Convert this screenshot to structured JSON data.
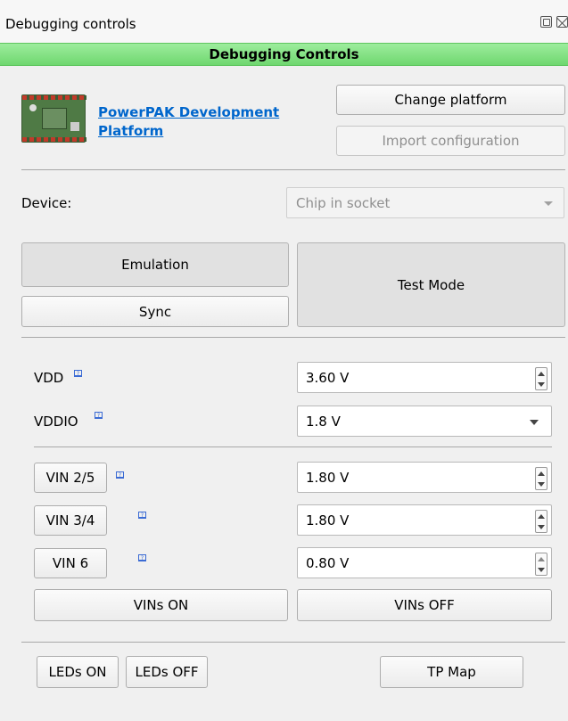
{
  "window": {
    "title": "Debugging controls",
    "restore_icon": "restore-icon",
    "close_icon": "close-icon"
  },
  "header": {
    "title": "Debugging Controls",
    "color": "#80e080"
  },
  "platform": {
    "link_line1": "PowerPAK Development",
    "link_line2": "Platform",
    "link_color": "#0066cc",
    "change_label": "Change platform",
    "import_label": "Import configuration"
  },
  "device": {
    "label": "Device:",
    "value": "Chip in socket"
  },
  "mode": {
    "emulation_label": "Emulation",
    "sync_label": "Sync",
    "test_mode_label": "Test Mode"
  },
  "power": {
    "vdd_label": "VDD",
    "vdd_value": "3.60 V",
    "vddio_label": "VDDIO",
    "vddio_value": "1.8 V"
  },
  "vins": [
    {
      "label": "VIN 2/5",
      "value": "1.80 V"
    },
    {
      "label": "VIN 3/4",
      "value": "1.80 V"
    },
    {
      "label": "VIN 6",
      "value": "0.80 V"
    }
  ],
  "vin_buttons": {
    "on_label": "VINs ON",
    "off_label": "VINs OFF"
  },
  "bottom": {
    "leds_on_label": "LEDs ON",
    "leds_off_label": "LEDs OFF",
    "tp_map_label": "TP Map"
  },
  "help_glyph": "?"
}
